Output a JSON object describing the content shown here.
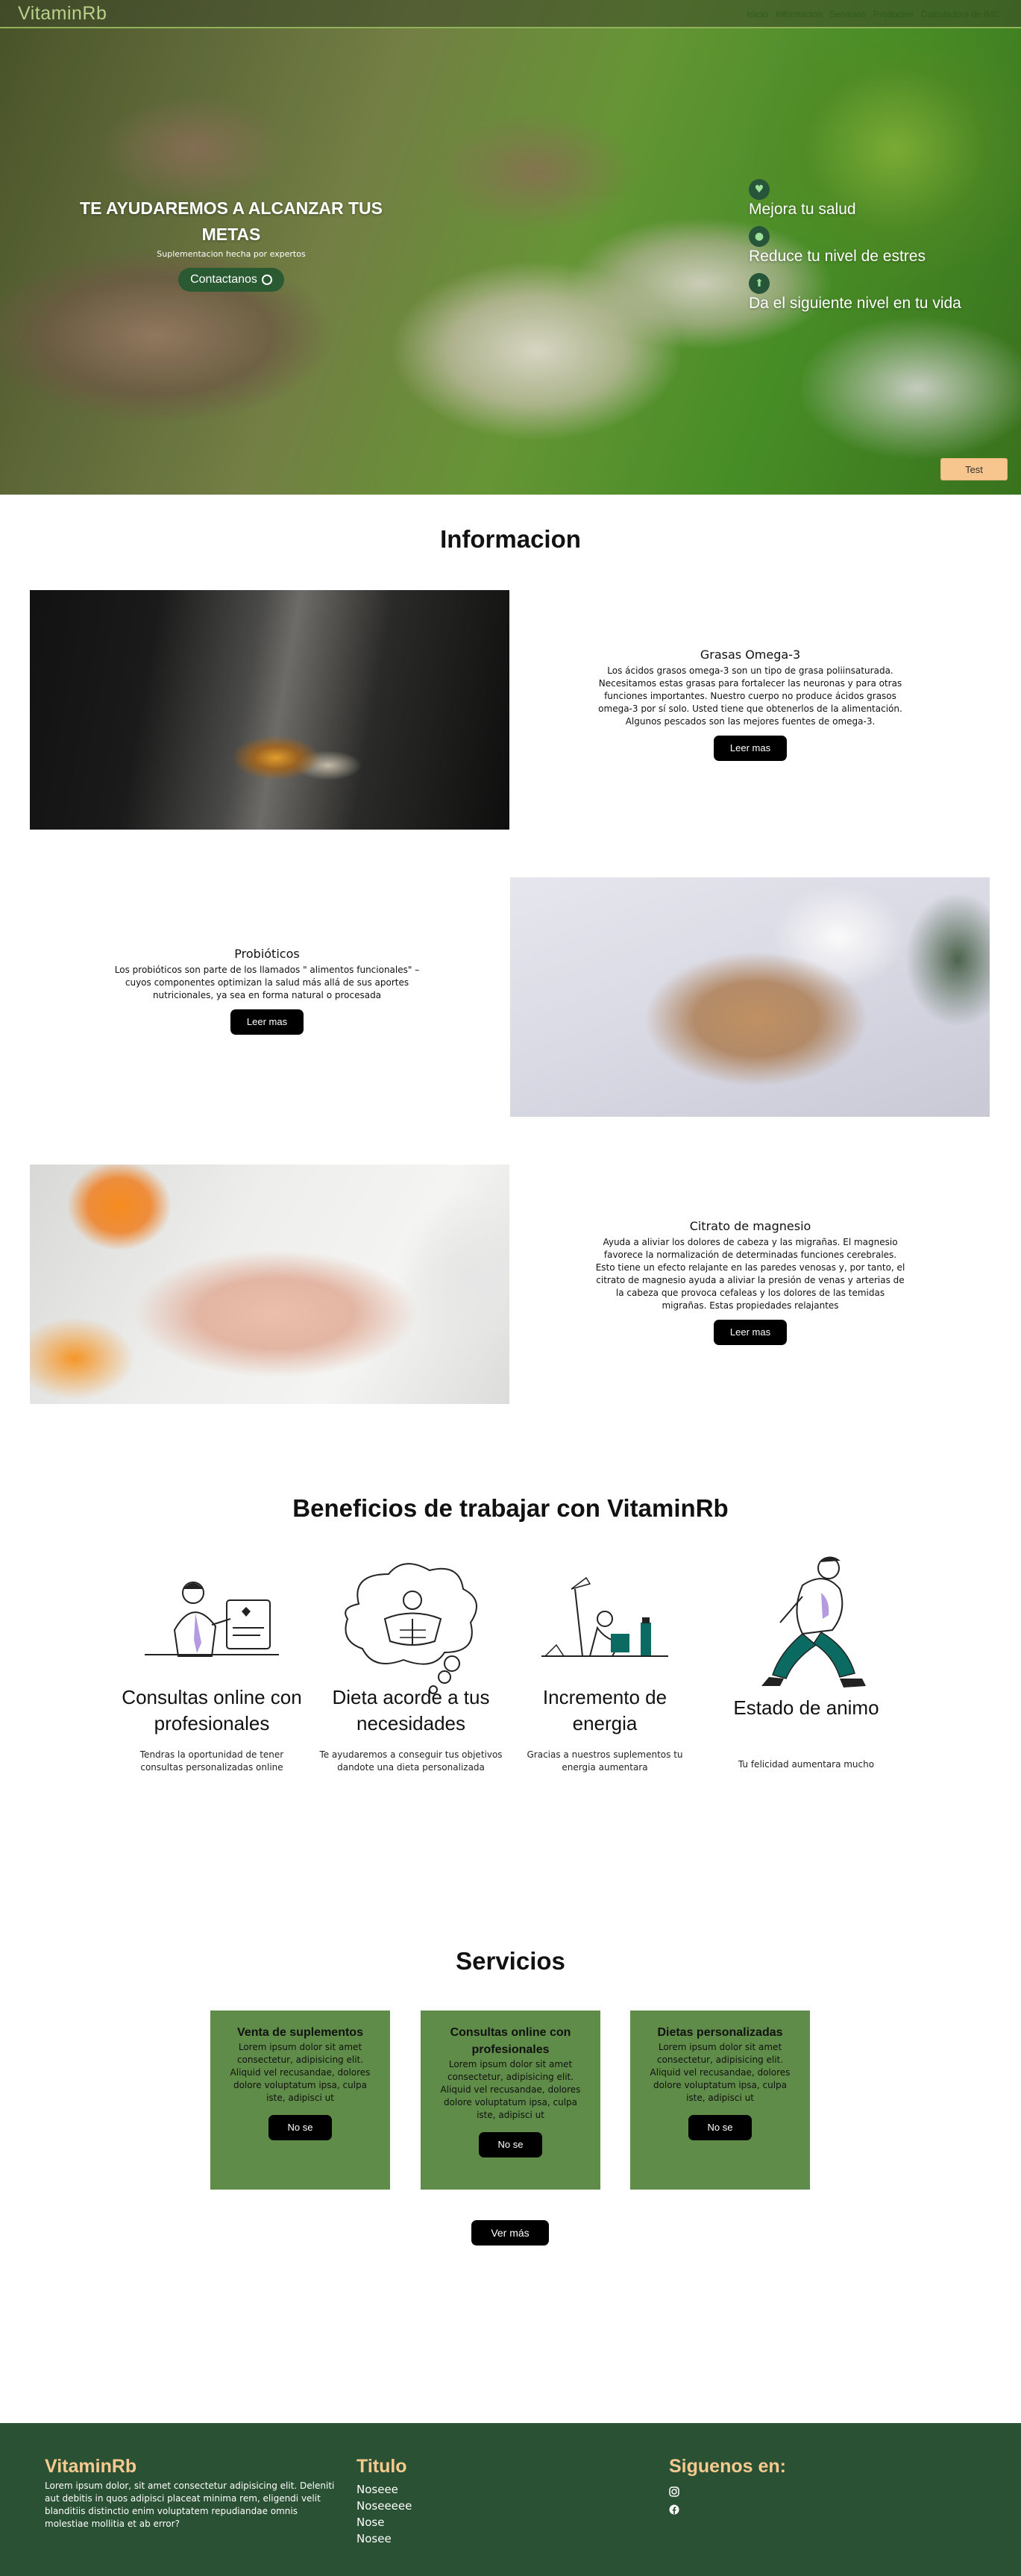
{
  "header": {
    "brand": "VitaminRb",
    "nav": [
      "Inicio",
      "Informacion",
      "Servicios",
      "Productos",
      "Calculadora de IMC"
    ]
  },
  "hero": {
    "title": "TE AYUDAREMOS A ALCANZAR TUS METAS",
    "subtitle": "Suplementacion hecha por expertos",
    "contact_label": "Contactanos",
    "features": [
      "Mejora tu salud",
      "Reduce tu nivel de estres",
      "Da el siguiente nivel en tu vida"
    ],
    "test_label": "Test"
  },
  "info": {
    "title": "Informacion",
    "items": [
      {
        "title": "Grasas Omega-3",
        "body": "Los ácidos grasos omega-3 son un tipo de grasa poliinsaturada. Necesitamos estas grasas para fortalecer las neuronas y para otras funciones importantes. Nuestro cuerpo no produce ácidos grasos omega-3 por sí solo. Usted tiene que obtenerlos de la alimentación. Algunos pescados son las mejores fuentes de omega-3.",
        "button": "Leer mas"
      },
      {
        "title": "Probióticos",
        "body": "Los probióticos son parte de los llamados \" alimentos funcionales\" –cuyos componentes optimizan la salud más allá de sus aportes nutricionales, ya sea en forma natural o procesada",
        "button": "Leer mas"
      },
      {
        "title": "Citrato de magnesio",
        "body": "Ayuda a aliviar los dolores de cabeza y las migrañas. El magnesio favorece la normalización de determinadas funciones cerebrales. Esto tiene un efecto relajante en las paredes venosas y, por tanto, el citrato de magnesio ayuda a aliviar la presión de venas y arterias de la cabeza que provoca cefaleas y los dolores de las temidas migrañas. Estas propiedades relajantes",
        "button": "Leer mas"
      }
    ]
  },
  "benefits": {
    "title": "Beneficios de trabajar con VitaminRb",
    "items": [
      {
        "title": "Consultas online con profesionales",
        "text": "Tendras la oportunidad de tener consultas personalizadas online"
      },
      {
        "title": "Dieta acorde a tus necesidades",
        "text": "Te ayudaremos a conseguir tus objetivos dandote una dieta personalizada"
      },
      {
        "title": "Incremento de energia",
        "text": "Gracias a nuestros suplementos tu energia aumentara"
      },
      {
        "title": "Estado de animo",
        "text": "Tu felicidad aumentara mucho"
      }
    ]
  },
  "services": {
    "title": "Servicios",
    "items": [
      {
        "title": "Venta de suplementos",
        "body": "Lorem ipsum dolor sit amet consectetur, adipisicing elit. Aliquid vel recusandae, dolores dolore voluptatum ipsa, culpa iste, adipisci ut",
        "button": "No se"
      },
      {
        "title": "Consultas online con profesionales",
        "body": "Lorem ipsum dolor sit amet consectetur, adipisicing elit. Aliquid vel recusandae, dolores dolore voluptatum ipsa, culpa iste, adipisci ut",
        "button": "No se"
      },
      {
        "title": "Dietas personalizadas",
        "body": "Lorem ipsum dolor sit amet consectetur, adipisicing elit. Aliquid vel recusandae, dolores dolore voluptatum ipsa, culpa iste, adipisci ut",
        "button": "No se"
      }
    ],
    "more_label": "Ver más"
  },
  "footer": {
    "brand": "VitaminRb",
    "description": "Lorem ipsum dolor, sit amet consectetur adipisicing elit. Deleniti aut debitis in quos adipisci placeat minima rem, eligendi velit blanditiis distinctio enim voluptatem repudiandae omnis molestiae mollitia et ab error?",
    "links_title": "Titulo",
    "links": [
      "Noseee",
      "Noseeeee",
      "Nose",
      "Nosee"
    ],
    "follow_title": "Siguenos en:",
    "social": [
      "instagram-icon",
      "facebook-icon"
    ]
  },
  "colors": {
    "accent_green": "#5f8c48",
    "footer_green": "#2a5134",
    "footer_accent": "#f6c98f",
    "test_button": "#f7c58e"
  }
}
